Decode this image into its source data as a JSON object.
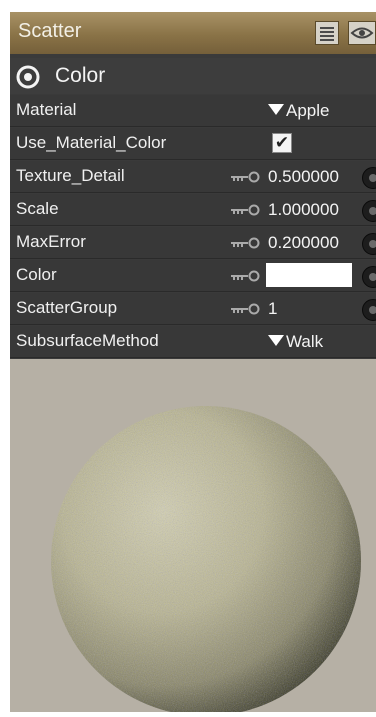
{
  "panel": {
    "title": "Scatter",
    "menu_button": "menu-icon",
    "eye_button": "eye-icon"
  },
  "section": {
    "title": "Color",
    "icon": "target-icon"
  },
  "properties": [
    {
      "label": "Material",
      "type": "dropdown",
      "value": "Apple"
    },
    {
      "label": "Use_Material_Color",
      "type": "checkbox",
      "checked": true,
      "mark": "✔"
    },
    {
      "label": "Texture_Detail",
      "type": "number",
      "value": "0.500000"
    },
    {
      "label": "Scale",
      "type": "number",
      "value": "1.000000"
    },
    {
      "label": "MaxError",
      "type": "number",
      "value": "0.200000"
    },
    {
      "label": "Color",
      "type": "color",
      "value": "#ffffff"
    },
    {
      "label": "ScatterGroup",
      "type": "number",
      "value": "1"
    },
    {
      "label": "SubsurfaceMethod",
      "type": "dropdown",
      "value": "Walk"
    }
  ],
  "colors": {
    "title_bar": "#8a7347",
    "panel_bg": "#3a3a3a",
    "preview_bg": "#b6b0a5"
  }
}
